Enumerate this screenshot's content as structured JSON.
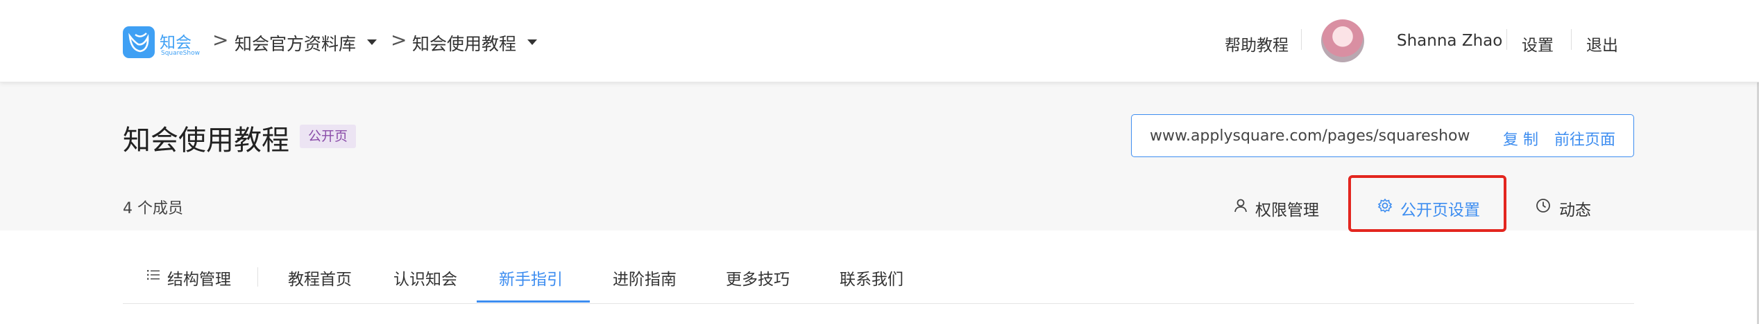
{
  "brand": {
    "name": "知会",
    "sub": "SquareShow"
  },
  "breadcrumb": [
    {
      "label": "知会官方资料库"
    },
    {
      "label": "知会使用教程"
    }
  ],
  "nav": {
    "help": "帮助教程",
    "user": "Shanna Zhao",
    "settings": "设置",
    "logout": "退出"
  },
  "page": {
    "title": "知会使用教程",
    "badge": "公开页",
    "members": "4 个成员",
    "url": "www.applysquare.com/pages/squareshow",
    "copy": "复 制",
    "goto": "前往页面",
    "actions": {
      "permissions": "权限管理",
      "public_settings": "公开页设置",
      "activity": "动态"
    }
  },
  "tabs": [
    {
      "label": "结构管理"
    },
    {
      "label": "教程首页"
    },
    {
      "label": "认识知会"
    },
    {
      "label": "新手指引",
      "active": true
    },
    {
      "label": "进阶指南"
    },
    {
      "label": "更多技巧"
    },
    {
      "label": "联系我们"
    }
  ],
  "colors": {
    "accent": "#3d8df0",
    "highlight": "#e3261f",
    "badge_bg": "#ece4f3",
    "badge_text": "#8a4ca8"
  }
}
